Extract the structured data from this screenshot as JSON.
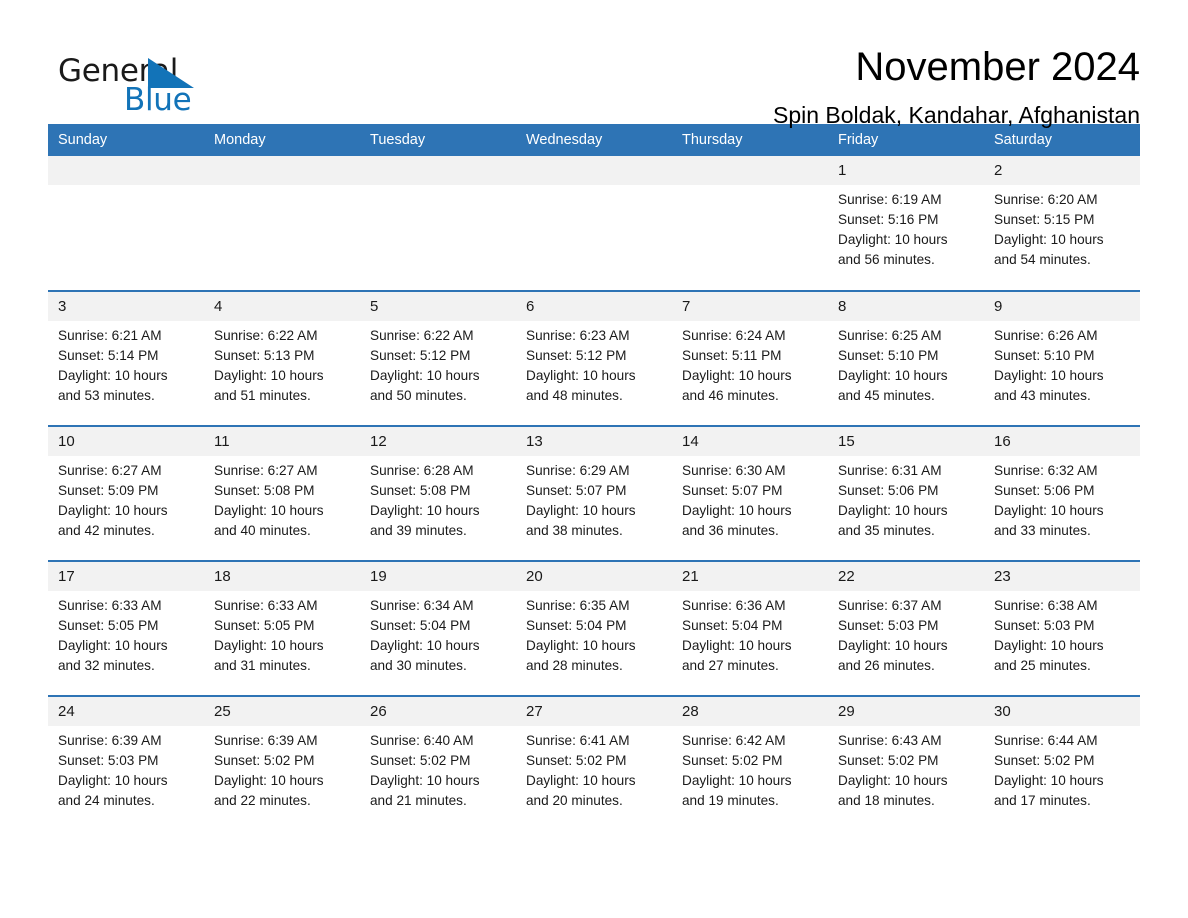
{
  "brand": {
    "word_general": "General",
    "word_blue": "Blue",
    "flag_icon": "triangle-flag-icon"
  },
  "header": {
    "title": "November 2024",
    "subtitle": "Spin Boldak, Kandahar, Afghanistan"
  },
  "colors": {
    "header_blue": "#2e74b5",
    "brand_blue": "#1273b8",
    "daynum_band": "#f2f2f2",
    "text": "#1a1a1a"
  },
  "weekday_headers": [
    "Sunday",
    "Monday",
    "Tuesday",
    "Wednesday",
    "Thursday",
    "Friday",
    "Saturday"
  ],
  "labels": {
    "sunrise_prefix": "Sunrise:",
    "sunset_prefix": "Sunset:",
    "daylight_prefix": "Daylight:"
  },
  "weeks": [
    [
      {
        "day": "",
        "empty": true
      },
      {
        "day": "",
        "empty": true
      },
      {
        "day": "",
        "empty": true
      },
      {
        "day": "",
        "empty": true
      },
      {
        "day": "",
        "empty": true
      },
      {
        "day": "1",
        "sunrise": "Sunrise: 6:19 AM",
        "sunset": "Sunset: 5:16 PM",
        "daylight_line1": "Daylight: 10 hours",
        "daylight_line2": "and 56 minutes."
      },
      {
        "day": "2",
        "sunrise": "Sunrise: 6:20 AM",
        "sunset": "Sunset: 5:15 PM",
        "daylight_line1": "Daylight: 10 hours",
        "daylight_line2": "and 54 minutes."
      }
    ],
    [
      {
        "day": "3",
        "sunrise": "Sunrise: 6:21 AM",
        "sunset": "Sunset: 5:14 PM",
        "daylight_line1": "Daylight: 10 hours",
        "daylight_line2": "and 53 minutes."
      },
      {
        "day": "4",
        "sunrise": "Sunrise: 6:22 AM",
        "sunset": "Sunset: 5:13 PM",
        "daylight_line1": "Daylight: 10 hours",
        "daylight_line2": "and 51 minutes."
      },
      {
        "day": "5",
        "sunrise": "Sunrise: 6:22 AM",
        "sunset": "Sunset: 5:12 PM",
        "daylight_line1": "Daylight: 10 hours",
        "daylight_line2": "and 50 minutes."
      },
      {
        "day": "6",
        "sunrise": "Sunrise: 6:23 AM",
        "sunset": "Sunset: 5:12 PM",
        "daylight_line1": "Daylight: 10 hours",
        "daylight_line2": "and 48 minutes."
      },
      {
        "day": "7",
        "sunrise": "Sunrise: 6:24 AM",
        "sunset": "Sunset: 5:11 PM",
        "daylight_line1": "Daylight: 10 hours",
        "daylight_line2": "and 46 minutes."
      },
      {
        "day": "8",
        "sunrise": "Sunrise: 6:25 AM",
        "sunset": "Sunset: 5:10 PM",
        "daylight_line1": "Daylight: 10 hours",
        "daylight_line2": "and 45 minutes."
      },
      {
        "day": "9",
        "sunrise": "Sunrise: 6:26 AM",
        "sunset": "Sunset: 5:10 PM",
        "daylight_line1": "Daylight: 10 hours",
        "daylight_line2": "and 43 minutes."
      }
    ],
    [
      {
        "day": "10",
        "sunrise": "Sunrise: 6:27 AM",
        "sunset": "Sunset: 5:09 PM",
        "daylight_line1": "Daylight: 10 hours",
        "daylight_line2": "and 42 minutes."
      },
      {
        "day": "11",
        "sunrise": "Sunrise: 6:27 AM",
        "sunset": "Sunset: 5:08 PM",
        "daylight_line1": "Daylight: 10 hours",
        "daylight_line2": "and 40 minutes."
      },
      {
        "day": "12",
        "sunrise": "Sunrise: 6:28 AM",
        "sunset": "Sunset: 5:08 PM",
        "daylight_line1": "Daylight: 10 hours",
        "daylight_line2": "and 39 minutes."
      },
      {
        "day": "13",
        "sunrise": "Sunrise: 6:29 AM",
        "sunset": "Sunset: 5:07 PM",
        "daylight_line1": "Daylight: 10 hours",
        "daylight_line2": "and 38 minutes."
      },
      {
        "day": "14",
        "sunrise": "Sunrise: 6:30 AM",
        "sunset": "Sunset: 5:07 PM",
        "daylight_line1": "Daylight: 10 hours",
        "daylight_line2": "and 36 minutes."
      },
      {
        "day": "15",
        "sunrise": "Sunrise: 6:31 AM",
        "sunset": "Sunset: 5:06 PM",
        "daylight_line1": "Daylight: 10 hours",
        "daylight_line2": "and 35 minutes."
      },
      {
        "day": "16",
        "sunrise": "Sunrise: 6:32 AM",
        "sunset": "Sunset: 5:06 PM",
        "daylight_line1": "Daylight: 10 hours",
        "daylight_line2": "and 33 minutes."
      }
    ],
    [
      {
        "day": "17",
        "sunrise": "Sunrise: 6:33 AM",
        "sunset": "Sunset: 5:05 PM",
        "daylight_line1": "Daylight: 10 hours",
        "daylight_line2": "and 32 minutes."
      },
      {
        "day": "18",
        "sunrise": "Sunrise: 6:33 AM",
        "sunset": "Sunset: 5:05 PM",
        "daylight_line1": "Daylight: 10 hours",
        "daylight_line2": "and 31 minutes."
      },
      {
        "day": "19",
        "sunrise": "Sunrise: 6:34 AM",
        "sunset": "Sunset: 5:04 PM",
        "daylight_line1": "Daylight: 10 hours",
        "daylight_line2": "and 30 minutes."
      },
      {
        "day": "20",
        "sunrise": "Sunrise: 6:35 AM",
        "sunset": "Sunset: 5:04 PM",
        "daylight_line1": "Daylight: 10 hours",
        "daylight_line2": "and 28 minutes."
      },
      {
        "day": "21",
        "sunrise": "Sunrise: 6:36 AM",
        "sunset": "Sunset: 5:04 PM",
        "daylight_line1": "Daylight: 10 hours",
        "daylight_line2": "and 27 minutes."
      },
      {
        "day": "22",
        "sunrise": "Sunrise: 6:37 AM",
        "sunset": "Sunset: 5:03 PM",
        "daylight_line1": "Daylight: 10 hours",
        "daylight_line2": "and 26 minutes."
      },
      {
        "day": "23",
        "sunrise": "Sunrise: 6:38 AM",
        "sunset": "Sunset: 5:03 PM",
        "daylight_line1": "Daylight: 10 hours",
        "daylight_line2": "and 25 minutes."
      }
    ],
    [
      {
        "day": "24",
        "sunrise": "Sunrise: 6:39 AM",
        "sunset": "Sunset: 5:03 PM",
        "daylight_line1": "Daylight: 10 hours",
        "daylight_line2": "and 24 minutes."
      },
      {
        "day": "25",
        "sunrise": "Sunrise: 6:39 AM",
        "sunset": "Sunset: 5:02 PM",
        "daylight_line1": "Daylight: 10 hours",
        "daylight_line2": "and 22 minutes."
      },
      {
        "day": "26",
        "sunrise": "Sunrise: 6:40 AM",
        "sunset": "Sunset: 5:02 PM",
        "daylight_line1": "Daylight: 10 hours",
        "daylight_line2": "and 21 minutes."
      },
      {
        "day": "27",
        "sunrise": "Sunrise: 6:41 AM",
        "sunset": "Sunset: 5:02 PM",
        "daylight_line1": "Daylight: 10 hours",
        "daylight_line2": "and 20 minutes."
      },
      {
        "day": "28",
        "sunrise": "Sunrise: 6:42 AM",
        "sunset": "Sunset: 5:02 PM",
        "daylight_line1": "Daylight: 10 hours",
        "daylight_line2": "and 19 minutes."
      },
      {
        "day": "29",
        "sunrise": "Sunrise: 6:43 AM",
        "sunset": "Sunset: 5:02 PM",
        "daylight_line1": "Daylight: 10 hours",
        "daylight_line2": "and 18 minutes."
      },
      {
        "day": "30",
        "sunrise": "Sunrise: 6:44 AM",
        "sunset": "Sunset: 5:02 PM",
        "daylight_line1": "Daylight: 10 hours",
        "daylight_line2": "and 17 minutes."
      }
    ]
  ]
}
